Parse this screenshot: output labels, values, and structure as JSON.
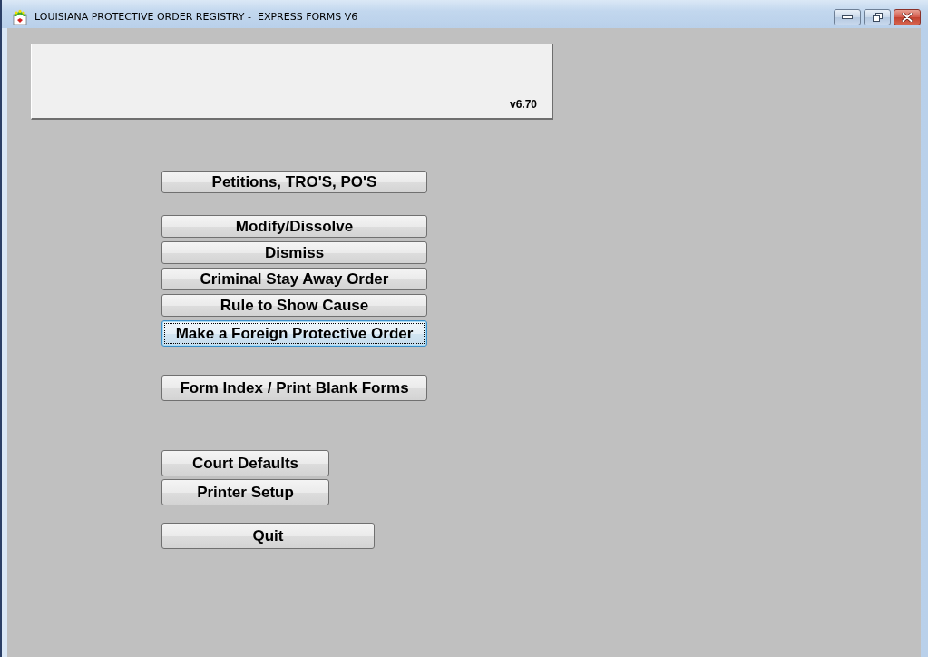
{
  "window": {
    "title": "LOUISIANA PROTECTIVE ORDER REGISTRY -  EXPRESS FORMS V6"
  },
  "header_panel": {
    "version": "v6.70"
  },
  "button_groups": [
    [
      {
        "label": "Petitions, TRO'S, PO'S",
        "focused": false
      }
    ],
    [
      {
        "label": "Modify/Dissolve",
        "focused": false
      },
      {
        "label": "Dismiss",
        "focused": false
      },
      {
        "label": "Criminal Stay Away Order",
        "focused": false
      },
      {
        "label": "Rule to Show Cause",
        "focused": false
      },
      {
        "label": "Make a Foreign Protective Order",
        "focused": true
      }
    ],
    [
      {
        "label": "Form Index / Print Blank Forms",
        "focused": false
      }
    ],
    [
      {
        "label": "Court Defaults",
        "focused": false
      },
      {
        "label": "Printer Setup",
        "focused": false
      }
    ],
    [
      {
        "label": "Quit",
        "focused": false
      }
    ]
  ]
}
